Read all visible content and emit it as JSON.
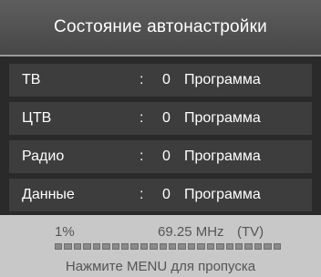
{
  "title": "Состояние автонастройки",
  "rows": [
    {
      "label": "ТВ",
      "colon": ":",
      "count": "0",
      "unit": "Программа"
    },
    {
      "label": "ЦТВ",
      "colon": ":",
      "count": "0",
      "unit": "Программа"
    },
    {
      "label": "Радио",
      "colon": ":",
      "count": "0",
      "unit": "Программа"
    },
    {
      "label": "Данные",
      "colon": ":",
      "count": "0",
      "unit": "Программа"
    }
  ],
  "status": {
    "percent": "1%",
    "frequency": "69.25 MHz",
    "source": "(TV)",
    "progress_fraction": 0.01,
    "hint": "Нажмите MENU для пропуска"
  },
  "colors": {
    "title_bg": "#555555",
    "row_bg": "#3d3d3d",
    "status_bg": "#c8c8c8",
    "text_light": "#ffffff",
    "text_dark": "#555555"
  }
}
